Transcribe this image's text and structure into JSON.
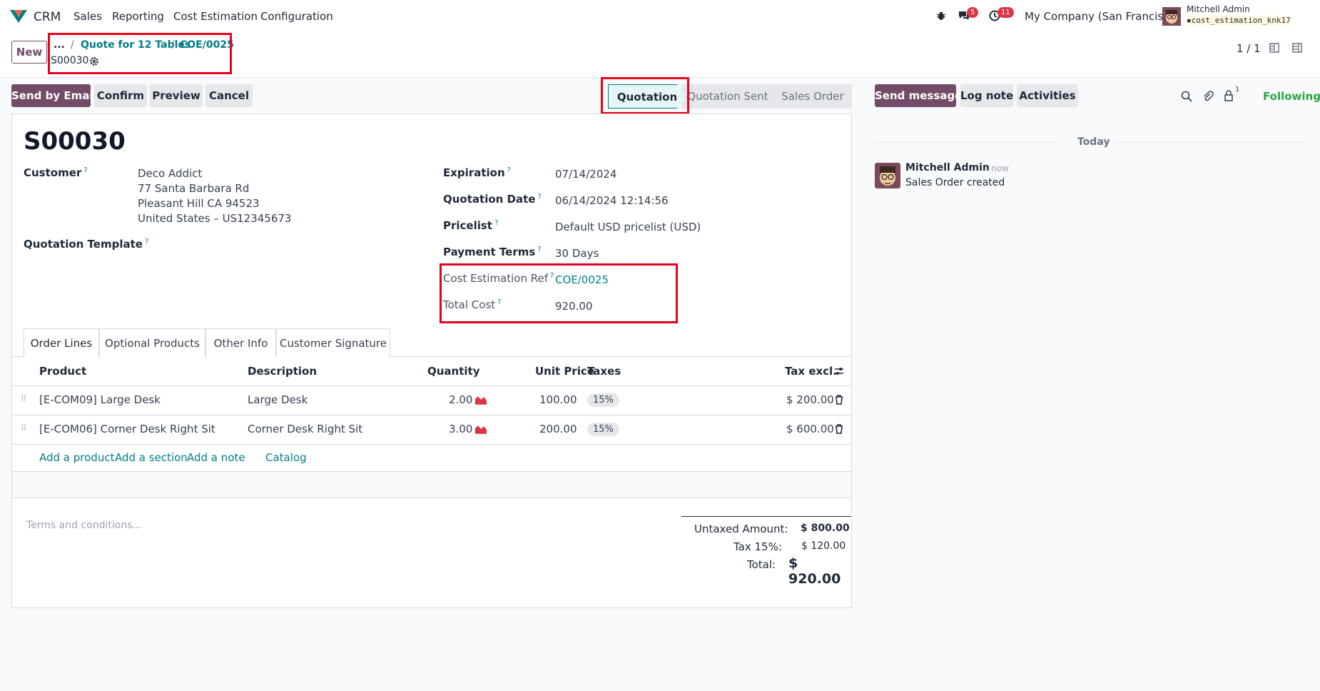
{
  "nav": {
    "app": "CRM",
    "menu": [
      "Sales",
      "Reporting",
      "Cost Estimation",
      "Configuration"
    ],
    "messages_count": "5",
    "activities_count": "11",
    "company": "My Company (San Francisco)",
    "user_name": "Mitchell Admin",
    "db_name": "cost_estimation_knk17"
  },
  "control": {
    "new_label": "New",
    "breadcrumb_dots": "...",
    "breadcrumb": [
      "Quote for 12 Tables",
      "COE/0025"
    ],
    "record_name": "S00030",
    "pager": "1 / 1"
  },
  "actions": {
    "send_email": "Send by Email",
    "confirm": "Confirm",
    "preview": "Preview",
    "cancel": "Cancel"
  },
  "stages": [
    "Quotation",
    "Quotation Sent",
    "Sales Order"
  ],
  "form": {
    "title": "S00030",
    "customer_label": "Customer",
    "customer_lines": [
      "Deco Addict",
      "77 Santa Barbara Rd",
      "Pleasant Hill CA 94523",
      "United States – US12345673"
    ],
    "template_label": "Quotation Template",
    "expiration_label": "Expiration",
    "expiration": "07/14/2024",
    "quotation_date_label": "Quotation Date",
    "quotation_date": "06/14/2024 12:14:56",
    "pricelist_label": "Pricelist",
    "pricelist": "Default USD pricelist (USD)",
    "payment_terms_label": "Payment Terms",
    "payment_terms": "30 Days",
    "cost_ref_label": "Cost Estimation Ref",
    "cost_ref": "COE/0025",
    "total_cost_label": "Total Cost",
    "total_cost": "920.00",
    "help_mark": "?"
  },
  "tabs": [
    "Order Lines",
    "Optional Products",
    "Other Info",
    "Customer Signature"
  ],
  "lines": {
    "headers": {
      "product": "Product",
      "description": "Description",
      "quantity": "Quantity",
      "unit_price": "Unit Price",
      "taxes": "Taxes",
      "tax_excl": "Tax excl."
    },
    "rows": [
      {
        "product": "[E-COM09] Large Desk",
        "description": "Large Desk",
        "quantity": "2.00",
        "unit_price": "100.00",
        "tax": "15%",
        "subtotal": "$ 200.00"
      },
      {
        "product": "[E-COM06] Corner Desk Right Sit",
        "description": "Corner Desk Right Sit",
        "quantity": "3.00",
        "unit_price": "200.00",
        "tax": "15%",
        "subtotal": "$ 600.00"
      }
    ],
    "add_product": "Add a product",
    "add_section": "Add a section",
    "add_note": "Add a note",
    "catalog": "Catalog"
  },
  "terms_placeholder": "Terms and conditions...",
  "totals": {
    "untaxed_label": "Untaxed Amount:",
    "untaxed": "$ 800.00",
    "tax_label": "Tax 15%:",
    "tax": "$ 120.00",
    "total_label": "Total:",
    "total": "$ 920.00"
  },
  "chatter": {
    "send_message": "Send message",
    "log_note": "Log note",
    "activities": "Activities",
    "followers_count": "1",
    "following": "Following",
    "today": "Today",
    "author": "Mitchell Admin",
    "time": "- now",
    "message": "Sales Order created"
  },
  "colors": {
    "brand": "#714b67",
    "link": "#017e84",
    "highlight": "#e5001c"
  }
}
